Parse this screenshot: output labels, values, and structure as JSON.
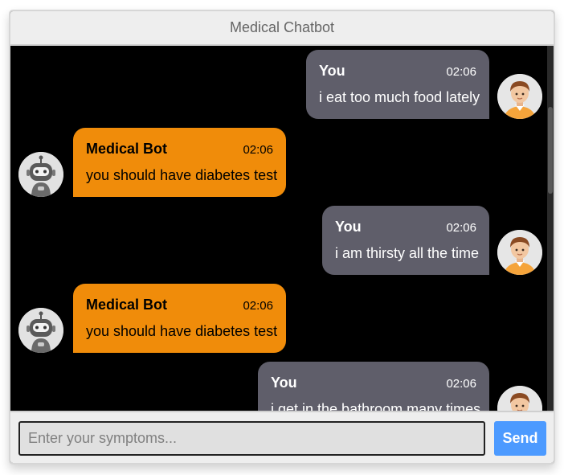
{
  "header": {
    "title": "Medical Chatbot"
  },
  "messages": [
    {
      "sender": "You",
      "time": "02:06",
      "text": "i eat too much food lately",
      "role": "user"
    },
    {
      "sender": "Medical Bot",
      "time": "02:06",
      "text": "you should have diabetes test",
      "role": "bot"
    },
    {
      "sender": "You",
      "time": "02:06",
      "text": "i am thirsty all the time",
      "role": "user"
    },
    {
      "sender": "Medical Bot",
      "time": "02:06",
      "text": "you should have diabetes test",
      "role": "bot"
    },
    {
      "sender": "You",
      "time": "02:06",
      "text": "i get in the bathroom many times",
      "role": "user"
    }
  ],
  "input": {
    "placeholder": "Enter your symptoms...",
    "value": ""
  },
  "send": {
    "label": "Send"
  },
  "colors": {
    "user_bubble": "#5f5e6a",
    "bot_bubble": "#f08c0a",
    "send_button": "#4c9aff",
    "chat_bg": "#000000"
  },
  "icons": {
    "user_avatar": "user-avatar-icon",
    "bot_avatar": "robot-avatar-icon"
  }
}
